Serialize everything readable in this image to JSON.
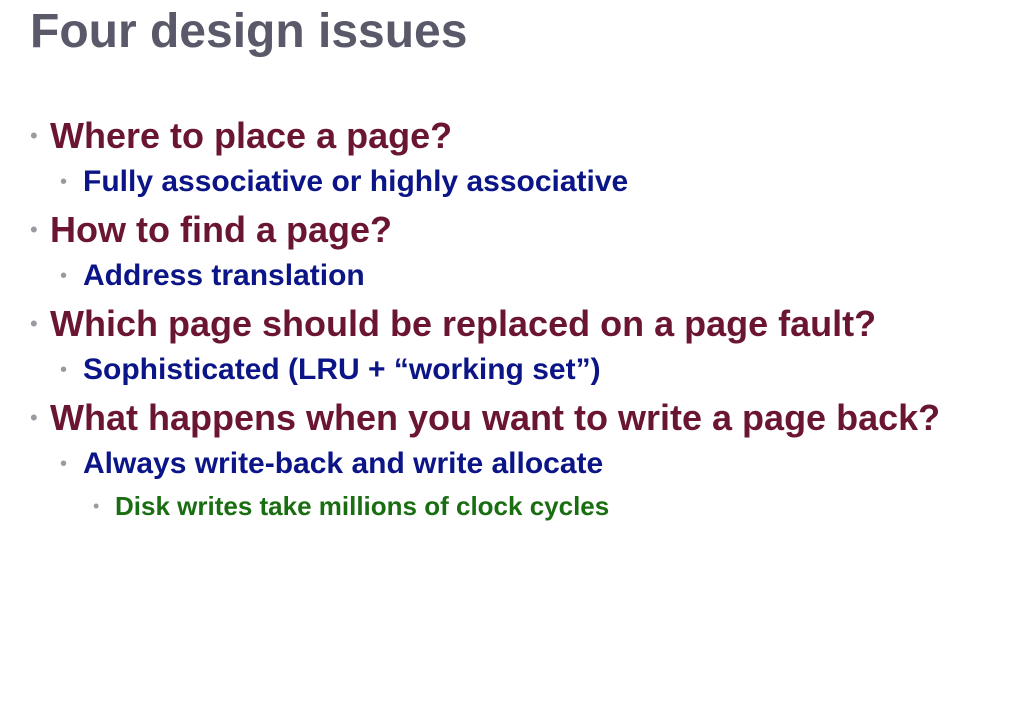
{
  "slide": {
    "title": "Four design issues",
    "bullet_glyph": "•",
    "colors": {
      "title": "#595969",
      "level1": "#6a1633",
      "level2": "#0b1587",
      "level3": "#1a6e12",
      "bullet": "#9a9aa0"
    },
    "items": [
      {
        "text": "Where to place a page?"
      },
      {
        "text": "Fully associative or highly associative"
      },
      {
        "text": "How to find a page?"
      },
      {
        "text": "Address translation"
      },
      {
        "text": "Which page should be replaced on a page fault?"
      },
      {
        "text": "Sophisticated (LRU + “working set”)"
      },
      {
        "text": "What happens when you want to write a page back?"
      },
      {
        "text": "Always write-back and write allocate"
      },
      {
        "text": "Disk writes take millions of clock cycles"
      }
    ]
  }
}
